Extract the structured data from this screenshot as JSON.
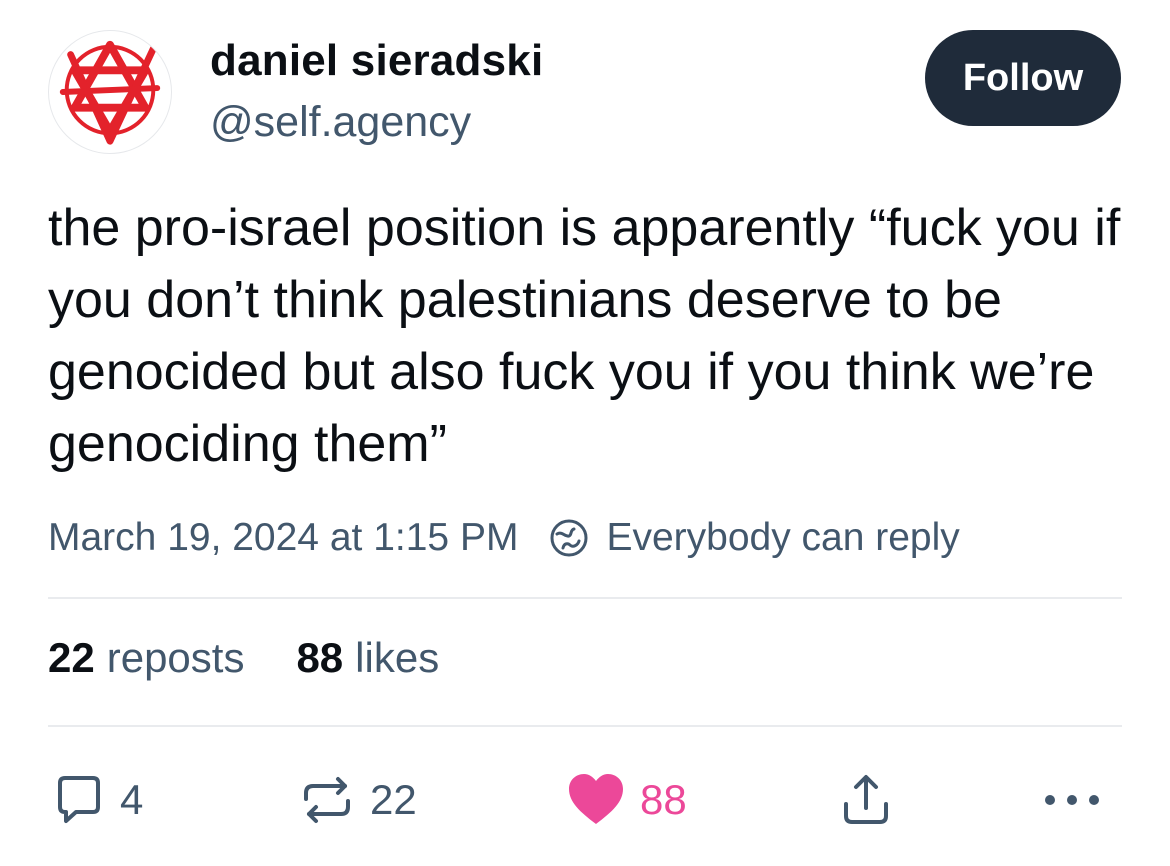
{
  "author": {
    "display_name": "daniel sieradski",
    "handle": "@self.agency",
    "avatar_icon": "anarchist-star-of-david-icon"
  },
  "follow_button": {
    "label": "Follow"
  },
  "post": {
    "text": "the pro-israel position is apparently “fuck you if you don’t think palestinians deserve to be genocided but also fuck you if you think we’re genociding them”",
    "timestamp": "March 19, 2024 at 1:15 PM",
    "reply_setting": "Everybody can reply",
    "reply_setting_icon": "globe-icon"
  },
  "stats": {
    "reposts_count": "22",
    "reposts_label": "reposts",
    "likes_count": "88",
    "likes_label": "likes"
  },
  "actions": {
    "reply": {
      "icon": "reply-icon",
      "count": "4"
    },
    "repost": {
      "icon": "repost-icon",
      "count": "22"
    },
    "like": {
      "icon": "heart-icon",
      "count": "88",
      "active": true,
      "color": "#ec4899"
    },
    "share": {
      "icon": "share-icon"
    },
    "more": {
      "icon": "more-icon"
    }
  },
  "colors": {
    "text_primary": "#0b0f14",
    "text_secondary": "#42576c",
    "follow_button_bg": "#1f2b3a",
    "like_active": "#ec4899",
    "avatar_red": "#e3222b"
  }
}
